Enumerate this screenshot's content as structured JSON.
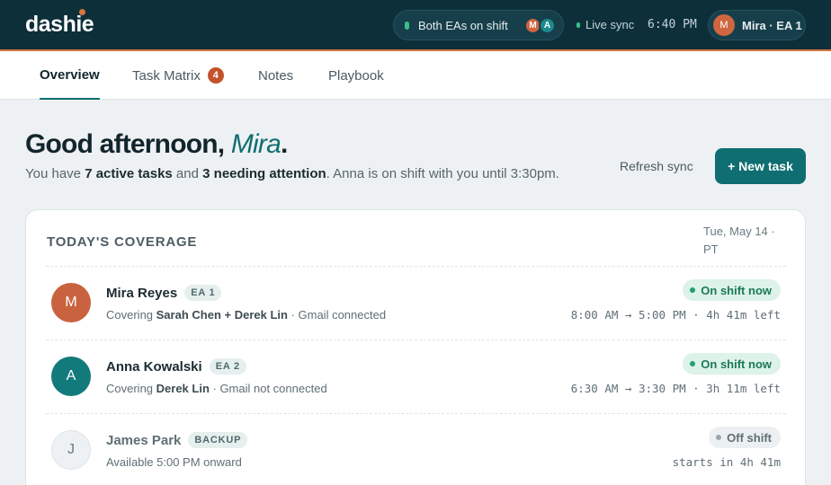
{
  "app": {
    "logo": "dashie"
  },
  "topbar": {
    "shift_label": "Both EAs on shift",
    "shift_avatars": [
      "M",
      "A"
    ],
    "sync_label": "Live sync",
    "time": "6:40 PM",
    "user": {
      "initial": "M",
      "label": "Mira · EA 1"
    }
  },
  "tabs": [
    {
      "label": "Overview",
      "active": true
    },
    {
      "label": "Task Matrix",
      "badge": "4"
    },
    {
      "label": "Notes"
    },
    {
      "label": "Playbook"
    }
  ],
  "greeting": {
    "prefix": "Good afternoon, ",
    "name": "Mira",
    "suffix": ".",
    "sub": {
      "p1": "You have ",
      "active": "7 active tasks",
      "p2": " and ",
      "attention": "3 needing attention",
      "p3": ". Anna is on shift with you until 3:30pm."
    }
  },
  "actions": {
    "refresh": "Refresh sync",
    "new_task": "+ New task"
  },
  "coverage": {
    "title": "TODAY'S COVERAGE",
    "date": "Tue, May 14 · PT",
    "people": [
      {
        "initial": "M",
        "name": "Mira Reyes",
        "role": "EA 1",
        "desc_prefix": "Covering ",
        "clients": "Sarah Chen + Derek Lin",
        "desc_suffix": " · Gmail connected",
        "status": "On shift now",
        "hours": "8:00 AM → 5:00 PM · 4h 41m left"
      },
      {
        "initial": "A",
        "name": "Anna Kowalski",
        "role": "EA 2",
        "desc_prefix": "Covering ",
        "clients": "Derek Lin",
        "desc_suffix": " · Gmail not connected",
        "status": "On shift now",
        "hours": "6:30 AM → 3:30 PM · 3h 11m left"
      },
      {
        "initial": "J",
        "name": "James Park",
        "role": "BACKUP",
        "desc_prefix": "Available 5:00 PM onward",
        "clients": "",
        "desc_suffix": "",
        "status": "Off shift",
        "hours": "starts in 4h 41m"
      }
    ]
  },
  "colors": {
    "nav_bg": "#0d2f3a",
    "accent": "#0f6e71",
    "orange": "#d7743f",
    "on_shift": "#1b7a55"
  }
}
